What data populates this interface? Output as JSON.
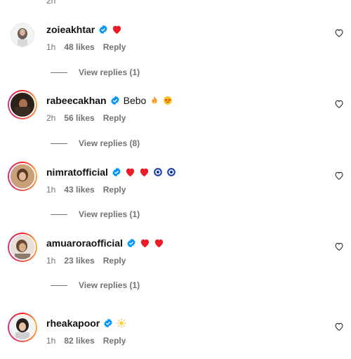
{
  "top_fragment": "2h",
  "comments": [
    {
      "username": "zoieakhtar",
      "text": "",
      "emojis": [
        "red-heart"
      ],
      "time": "1h",
      "likes": "48 likes",
      "reply_label": "Reply",
      "view_replies": "View replies (1)"
    },
    {
      "username": "rabeecakhan",
      "text": "Bebo",
      "emojis": [
        "fire",
        "heart-eyes"
      ],
      "time": "2h",
      "likes": "56 likes",
      "reply_label": "Reply",
      "view_replies": "View replies (8)"
    },
    {
      "username": "nimratofficial",
      "text": "",
      "emojis": [
        "red-heart",
        "red-heart",
        "nazar-amulet",
        "nazar-amulet"
      ],
      "time": "1h",
      "likes": "43 likes",
      "reply_label": "Reply",
      "view_replies": "View replies (1)"
    },
    {
      "username": "amuaroraofficial",
      "text": "",
      "emojis": [
        "red-heart",
        "red-heart"
      ],
      "time": "1h",
      "likes": "23 likes",
      "reply_label": "Reply",
      "view_replies": "View replies (1)"
    },
    {
      "username": "rheakapoor",
      "text": "",
      "emojis": [
        "sun"
      ],
      "time": "1h",
      "likes": "82 likes",
      "reply_label": "Reply",
      "view_replies": ""
    }
  ],
  "colors": {
    "verified": "#0095f6",
    "heart": "#ed1c24",
    "meta_text": "#737373",
    "story_ring_start": "#fcaf45",
    "story_ring_end": "#c13584"
  }
}
